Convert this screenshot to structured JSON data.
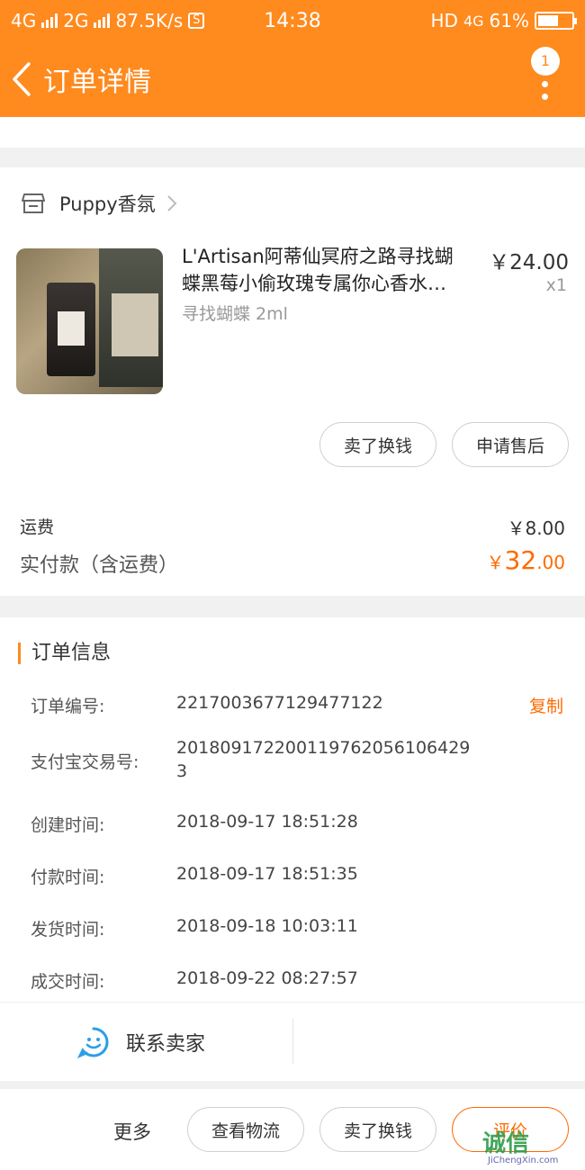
{
  "status": {
    "net1": "4G",
    "net2": "2G",
    "speed": "87.5K/s",
    "s_icon": "S",
    "time": "14:38",
    "hd": "HD",
    "lte": "4G",
    "battery": "61%",
    "battery_level": 0.61
  },
  "nav": {
    "title": "订单详情",
    "badge": "1"
  },
  "shop": {
    "name": "Puppy香氛",
    "icon": "store-icon"
  },
  "product": {
    "title_line1": "L'Artisan阿蒂仙冥府之路寻找蝴",
    "title_line2": "蝶黑莓小偷玫瑰专属你心香水…",
    "variant": "寻找蝴蝶 2ml",
    "price": "￥24.00",
    "qty": "x1"
  },
  "actions": {
    "sell": "卖了换钱",
    "aftersale": "申请售后"
  },
  "fees": {
    "shipping_label": "运费",
    "shipping_value": "￥8.00",
    "paid_label": "实付款（含运费）",
    "paid_symbol": "￥",
    "paid_int": "32",
    "paid_cents": ".00"
  },
  "info": {
    "title": "订单信息",
    "order_no_label": "订单编号:",
    "order_no": "2217003677129477122",
    "copy": "复制",
    "alipay_label": "支付宝交易号:",
    "alipay_line1": "20180917220011976205610642​9",
    "alipay_line2": "3",
    "created_label": "创建时间:",
    "created": "2018-09-17 18:51:28",
    "paid_label": "付款时间:",
    "paid": "2018-09-17 18:51:35",
    "shipped_label": "发货时间:",
    "shipped": "2018-09-18 10:03:11",
    "closed_label": "成交时间:",
    "closed": "2018-09-22 08:27:57"
  },
  "contact": {
    "label": "联系卖家"
  },
  "bottom": {
    "more": "更多",
    "logistics": "查看物流",
    "sell": "卖了换钱",
    "evaluate": "评价"
  },
  "watermark": {
    "text1": "诚信",
    "text2": "JiChengXin.com"
  },
  "colors": {
    "accent": "#ff8a1e",
    "price": "#ff6a00"
  }
}
